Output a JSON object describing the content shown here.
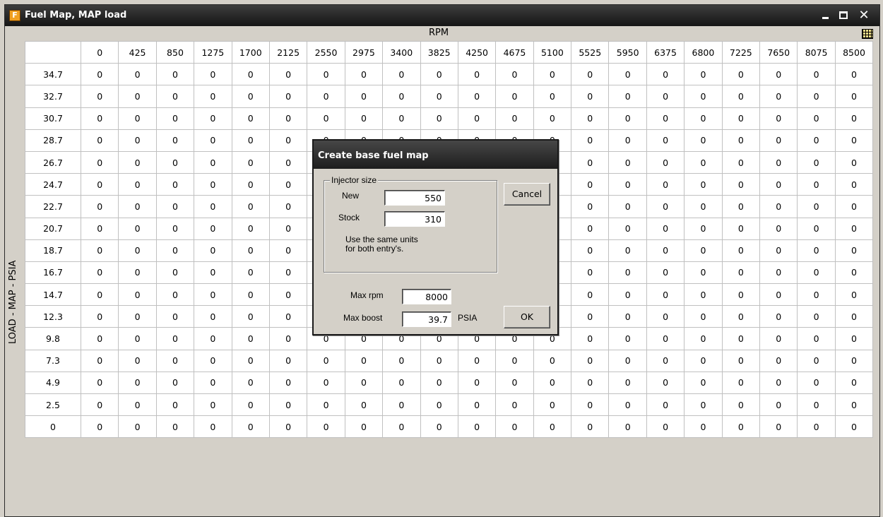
{
  "window": {
    "title": "Fuel Map, MAP load",
    "app_icon_letter": "F"
  },
  "axes": {
    "rpm_label": "RPM",
    "load_label": "LOAD - MAP - PSIA"
  },
  "table": {
    "rpm_columns": [
      "0",
      "425",
      "850",
      "1275",
      "1700",
      "2125",
      "2550",
      "2975",
      "3400",
      "3825",
      "4250",
      "4675",
      "5100",
      "5525",
      "5950",
      "6375",
      "6800",
      "7225",
      "7650",
      "8075",
      "8500"
    ],
    "load_rows": [
      "34.7",
      "32.7",
      "30.7",
      "28.7",
      "26.7",
      "24.7",
      "22.7",
      "20.7",
      "18.7",
      "16.7",
      "14.7",
      "12.3",
      "9.8",
      "7.3",
      "4.9",
      "2.5",
      "0"
    ],
    "cell_value": "0"
  },
  "dialog": {
    "title": "Create base fuel map",
    "group_label": "Injector size",
    "new_label": "New",
    "new_value": "550",
    "stock_label": "Stock",
    "stock_value": "310",
    "note": "Use the same units for both entry's.",
    "max_rpm_label": "Max rpm",
    "max_rpm_value": "8000",
    "max_boost_label": "Max boost",
    "max_boost_value": "39.7",
    "boost_unit": "PSIA",
    "cancel_label": "Cancel",
    "ok_label": "OK"
  },
  "icons": [
    "app-icon",
    "minimize-icon",
    "maximize-icon",
    "close-icon",
    "grid-icon"
  ],
  "colors": {
    "titlebar": "#1d1d1d",
    "window_bg": "#d4d0c8",
    "grid_bg": "#ffffff"
  }
}
